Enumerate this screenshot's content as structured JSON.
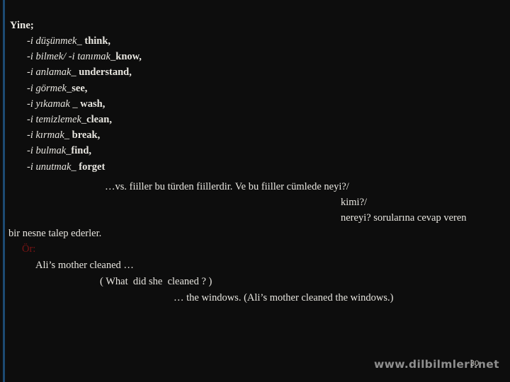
{
  "slide": {
    "page_number": "30",
    "background_color": "#0d0d0d",
    "accent_bar_color": "#1c4a72",
    "text_color": "#eceae4",
    "example_label_color": "#7a1414",
    "watermark": "www.dilbilmleri.net"
  },
  "heading": "Yine;",
  "verb_list": [
    {
      "prefix": "-i ",
      "turkish": "düşünmek",
      "separator": "_ ",
      "english": "think,"
    },
    {
      "prefix": "-i ",
      "turkish": "bilmek/ -i tanımak",
      "separator": "_",
      "english": "know,"
    },
    {
      "prefix": "-i ",
      "turkish": "anlamak",
      "separator": "_ ",
      "english": "understand,"
    },
    {
      "prefix": "-i ",
      "turkish": "görmek",
      "separator": "_",
      "english": "see,"
    },
    {
      "prefix": "-i ",
      "turkish": "yıkamak",
      "separator": " _ ",
      "english": "wash,"
    },
    {
      "prefix": "-i ",
      "turkish": "temizlemek",
      "separator": "_",
      "english": "clean,"
    },
    {
      "prefix": "-i ",
      "turkish": "kırmak",
      "separator": "_ ",
      "english": "break,"
    },
    {
      "prefix": "-i ",
      "turkish": "bulmak",
      "separator": "_",
      "english": "find,"
    },
    {
      "prefix": "-i ",
      "turkish": "unutmak",
      "separator": "_ ",
      "english": "forget"
    }
  ],
  "body": {
    "line_1": "…vs. fiiller bu türden fiillerdir. Ve bu fiiller cümlede neyi?/",
    "line_2": "kimi?/",
    "line_3": "nereyi? sorularına cevap veren",
    "line_4": "bir nesne talep ederler."
  },
  "example": {
    "label": "Ör:",
    "line_1": "Ali’s mother cleaned …",
    "line_2": "( What  did she  cleaned ? )",
    "line_3": "… the windows. (Ali’s mother cleaned the windows.)"
  }
}
